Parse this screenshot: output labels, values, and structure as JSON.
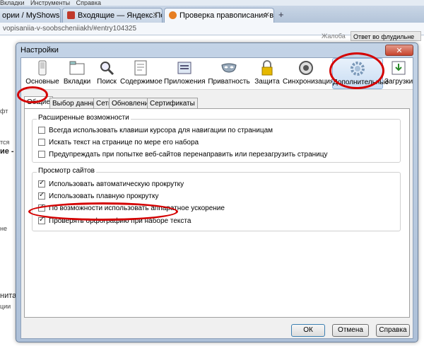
{
  "browser": {
    "menu": [
      "Вкладки",
      "Инструменты",
      "Справка"
    ],
    "tabs": [
      {
        "label": "ории / MyShows.me",
        "active": false
      },
      {
        "label": "Входящие — Яндекс.Почта",
        "active": false
      },
      {
        "label": "Проверка правописания в...",
        "active": true
      }
    ],
    "tab_close": "✕",
    "url": "vopisaniia-v-soobscheniiakh/#entry104325",
    "top_buttons": [
      "Жалоба",
      "Ответ во флудильне"
    ],
    "side_fragments": [
      "фт",
      "тся",
      "ие - в",
      "не",
      "нита",
      "ции"
    ]
  },
  "dialog": {
    "title": "Настройки",
    "close": "✕",
    "toolbar": [
      {
        "label": "Основные",
        "icon": "switch-icon"
      },
      {
        "label": "Вкладки",
        "icon": "tabs-icon"
      },
      {
        "label": "Поиск",
        "icon": "magnifier-icon"
      },
      {
        "label": "Содержимое",
        "icon": "content-icon"
      },
      {
        "label": "Приложения",
        "icon": "applications-icon"
      },
      {
        "label": "Приватность",
        "icon": "mask-icon"
      },
      {
        "label": "Защита",
        "icon": "lock-icon"
      },
      {
        "label": "Синхронизация",
        "icon": "sync-icon"
      },
      {
        "label": "Дополнительные",
        "icon": "gear-icon"
      },
      {
        "label": "Загрузки",
        "icon": "downloads-icon"
      }
    ],
    "selected_toolbar": "Дополнительные",
    "subtabs": [
      "Общие",
      "Выбор данных",
      "Сеть",
      "Обновления",
      "Сертификаты"
    ],
    "active_subtab": "Общие",
    "group_accessibility": {
      "title": "Расширенные возможности",
      "items": [
        {
          "label": "Всегда использовать клавиши курсора для навигации по страницам",
          "checked": false
        },
        {
          "label": "Искать текст на странице по мере его набора",
          "checked": false
        },
        {
          "label": "Предупреждать при попытке веб-сайтов перенаправить или перезагрузить страницу",
          "checked": false
        }
      ]
    },
    "group_browsing": {
      "title": "Просмотр сайтов",
      "items": [
        {
          "label": "Использовать автоматическую прокрутку",
          "checked": true
        },
        {
          "label": "Использовать плавную прокрутку",
          "checked": true
        },
        {
          "label": "По возможности использовать аппаратное ускорение",
          "checked": true
        },
        {
          "label": "Проверять орфографию при наборе текста",
          "checked": true
        }
      ]
    },
    "buttons": {
      "ok": "ОК",
      "cancel": "Отмена",
      "help": "Справка"
    },
    "annotation_color": "#d40000"
  }
}
